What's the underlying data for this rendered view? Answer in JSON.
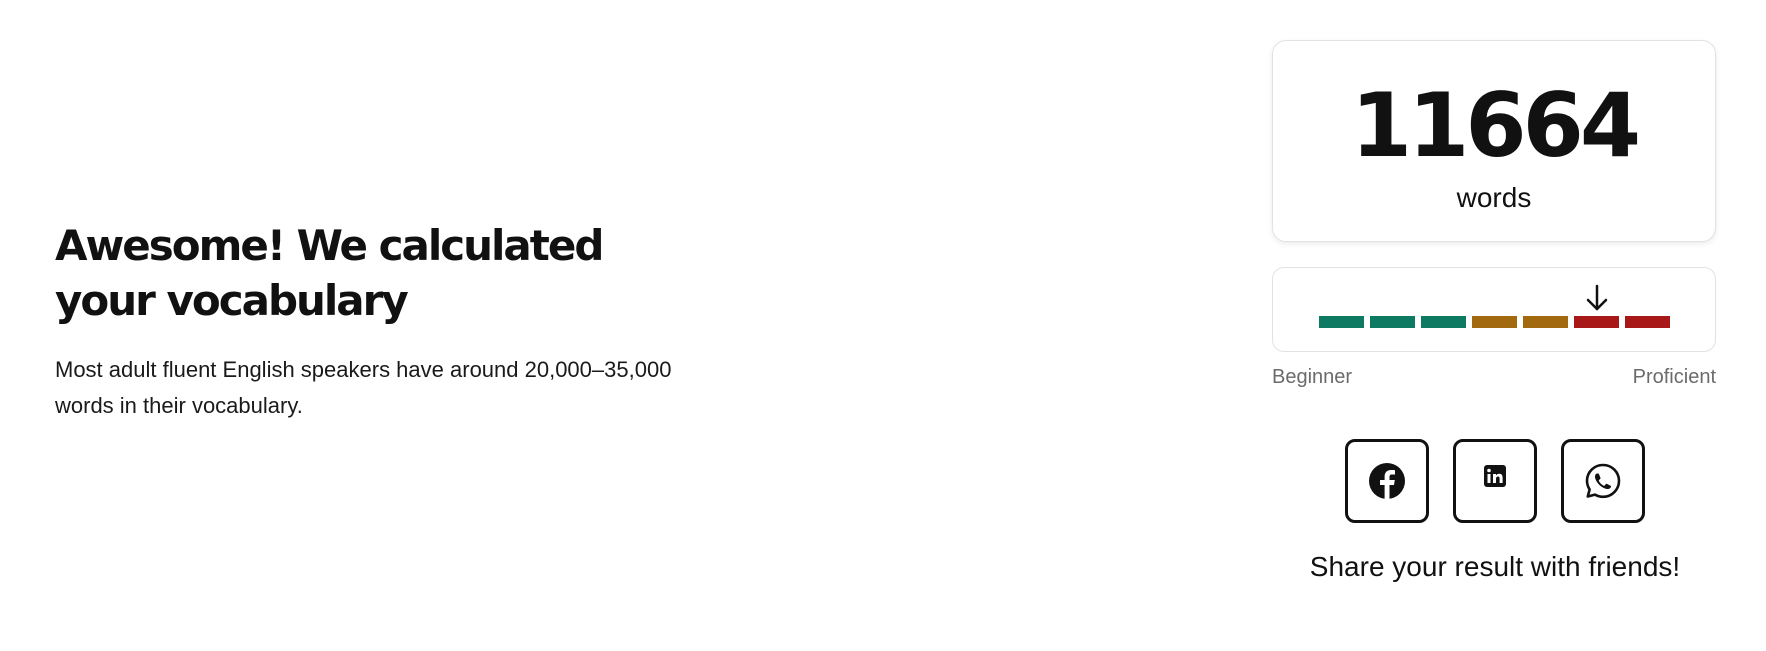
{
  "results": {
    "headline": "Awesome! We calculated your vocabulary",
    "description": "Most adult fluent English speakers have around 20,000–35,000 words in their vocabulary."
  },
  "score": {
    "value": "11664",
    "unit": "words"
  },
  "level_meter": {
    "segments": [
      {
        "color": "#0f7a62"
      },
      {
        "color": "#0f7a62"
      },
      {
        "color": "#0f7a62"
      },
      {
        "color": "#a3690f"
      },
      {
        "color": "#a3690f"
      },
      {
        "color": "#a81818"
      },
      {
        "color": "#a81818"
      }
    ],
    "current_segment_index": 5,
    "indicator_icon": "arrow-down-icon",
    "min_label": "Beginner",
    "max_label": "Proficient"
  },
  "share": {
    "buttons": [
      {
        "icon": "facebook-icon"
      },
      {
        "icon": "linkedin-icon"
      },
      {
        "icon": "whatsapp-icon"
      }
    ],
    "caption": "Share your result with friends!"
  }
}
